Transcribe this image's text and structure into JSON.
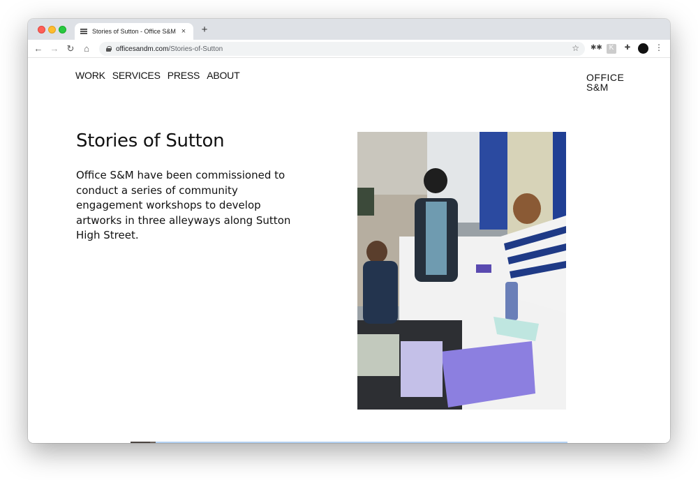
{
  "browser": {
    "tab_title": "Stories of Sutton - Office S&M",
    "tab_close": "×",
    "new_tab": "+",
    "url_host": "officesandm.com",
    "url_path": "/Stories-of-Sutton",
    "nav": {
      "back": "←",
      "forward": "→",
      "reload": "↻",
      "home": "⌂"
    },
    "bookmark_star": "☆",
    "menu": "⋮",
    "extensions": {
      "ext1": "✱✱",
      "ext2": "K",
      "puzzle": "✚"
    }
  },
  "site": {
    "nav": [
      "WORK",
      "SERVICES",
      "PRESS",
      "ABOUT"
    ],
    "logo_line1": "OFFICE",
    "logo_line2": "S&M"
  },
  "main": {
    "title": "Stories of Sutton",
    "intro": "Office S&M have been commissioned to conduct a series of community engagement workshops to develop artworks in three alleyways along Sutton High Street."
  },
  "icons": {
    "favicon": "office-sm-favicon",
    "lock": "lock-icon",
    "star": "star-icon"
  }
}
